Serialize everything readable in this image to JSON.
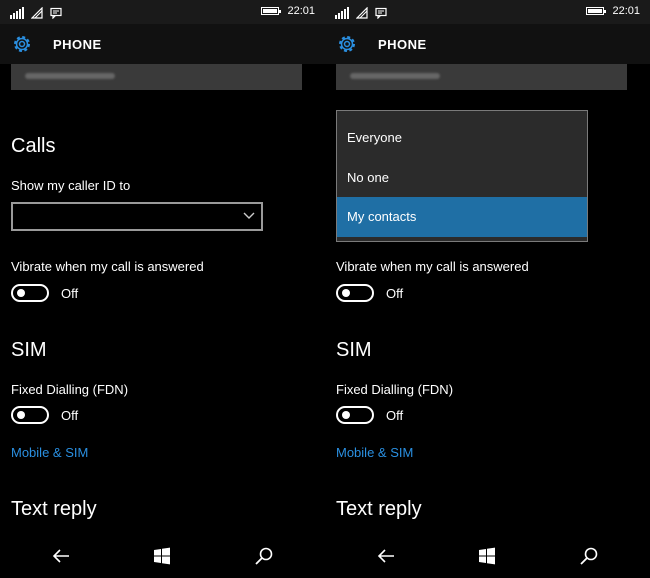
{
  "status": {
    "time": "22:01"
  },
  "header": {
    "title": "PHONE",
    "icon": "gear-icon"
  },
  "calls": {
    "title": "Calls",
    "caller_id_label": "Show my caller ID to",
    "caller_id_value": "",
    "vibrate_label": "Vibrate when my call is answered",
    "vibrate_state": "Off"
  },
  "sim": {
    "title": "SIM",
    "fdn_label": "Fixed Dialling (FDN)",
    "fdn_state": "Off",
    "mobile_sim_link": "Mobile & SIM"
  },
  "text_reply": {
    "title": "Text reply"
  },
  "dropdown": {
    "options": [
      "Everyone",
      "No one",
      "My contacts"
    ],
    "selected": "My contacts"
  },
  "colors": {
    "accent": "#1f6fa5",
    "link": "#2a8fe0",
    "background": "#000000"
  },
  "nav": {
    "back": "back-arrow-icon",
    "start": "windows-start-icon",
    "search": "search-icon"
  }
}
